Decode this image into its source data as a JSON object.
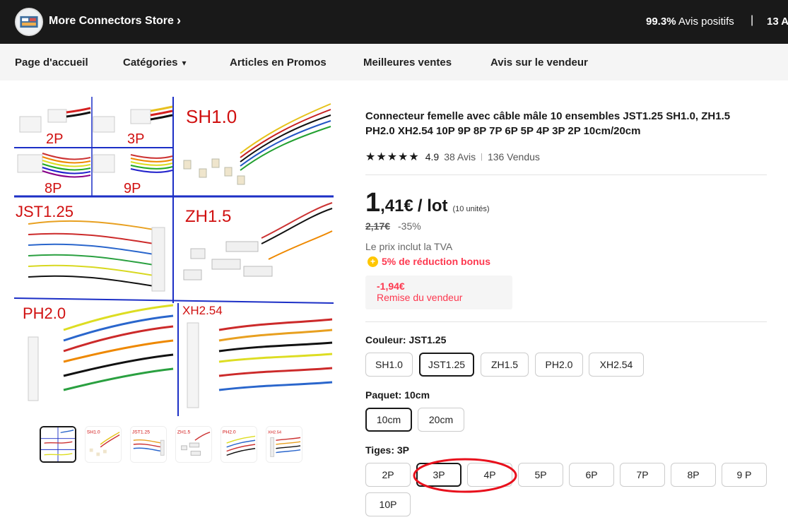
{
  "store": {
    "name": "More Connectors Store",
    "positive_reviews_value": "99.3%",
    "positive_reviews_label": "Avis positifs",
    "followers_partial": "13 A"
  },
  "nav": {
    "home": "Page d'accueil",
    "categories": "Catégories",
    "promos": "Articles en Promos",
    "bestsellers": "Meilleures ventes",
    "seller_reviews": "Avis sur le vendeur"
  },
  "gallery": {
    "image_labels": [
      "2P",
      "3P",
      "SH1.0",
      "8P",
      "9P",
      "JST1.25",
      "ZH1.5",
      "PH2.0",
      "XH2.54"
    ],
    "thumb_labels": [
      "SH1.0",
      "JST1.25",
      "ZH1.5",
      "PH2.0",
      "XH2.54"
    ],
    "selected_thumb": 0
  },
  "product": {
    "title": "Connecteur femelle avec câble mâle 10 ensembles JST1.25 SH1.0, ZH1.5 PH2.0 XH2.54 10P 9P 8P 7P 6P 5P 4P 3P 2P 10cm/20cm",
    "stars": "★★★★★",
    "rating": "4.9",
    "reviews": "38 Avis",
    "sold": "136 Vendus",
    "price_int": "1",
    "price_dec": ",41€",
    "price_unit": "/ lot",
    "price_lot": "(10 unités)",
    "old_price": "2,17€",
    "discount": "-35%",
    "vat": "Le prix inclut la TVA",
    "bonus": "5% de réduction bonus",
    "coupon_amount": "-1,94€",
    "coupon_label": "Remise du vendeur"
  },
  "color": {
    "label": "Couleur: JST1.25",
    "options": [
      "SH1.0",
      "JST1.25",
      "ZH1.5",
      "PH2.0",
      "XH2.54"
    ],
    "selected": "JST1.25"
  },
  "package": {
    "label": "Paquet: 10cm",
    "options": [
      "10cm",
      "20cm"
    ],
    "selected": "10cm"
  },
  "pins": {
    "label": "Tiges: 3P",
    "options": [
      "2P",
      "3P",
      "4P",
      "5P",
      "6P",
      "7P",
      "8P",
      "9 P",
      "10P"
    ],
    "selected": "3P"
  },
  "colors": {
    "accent_red": "#fd384f",
    "annotation_red": "#e8101c",
    "dark": "#191919"
  }
}
